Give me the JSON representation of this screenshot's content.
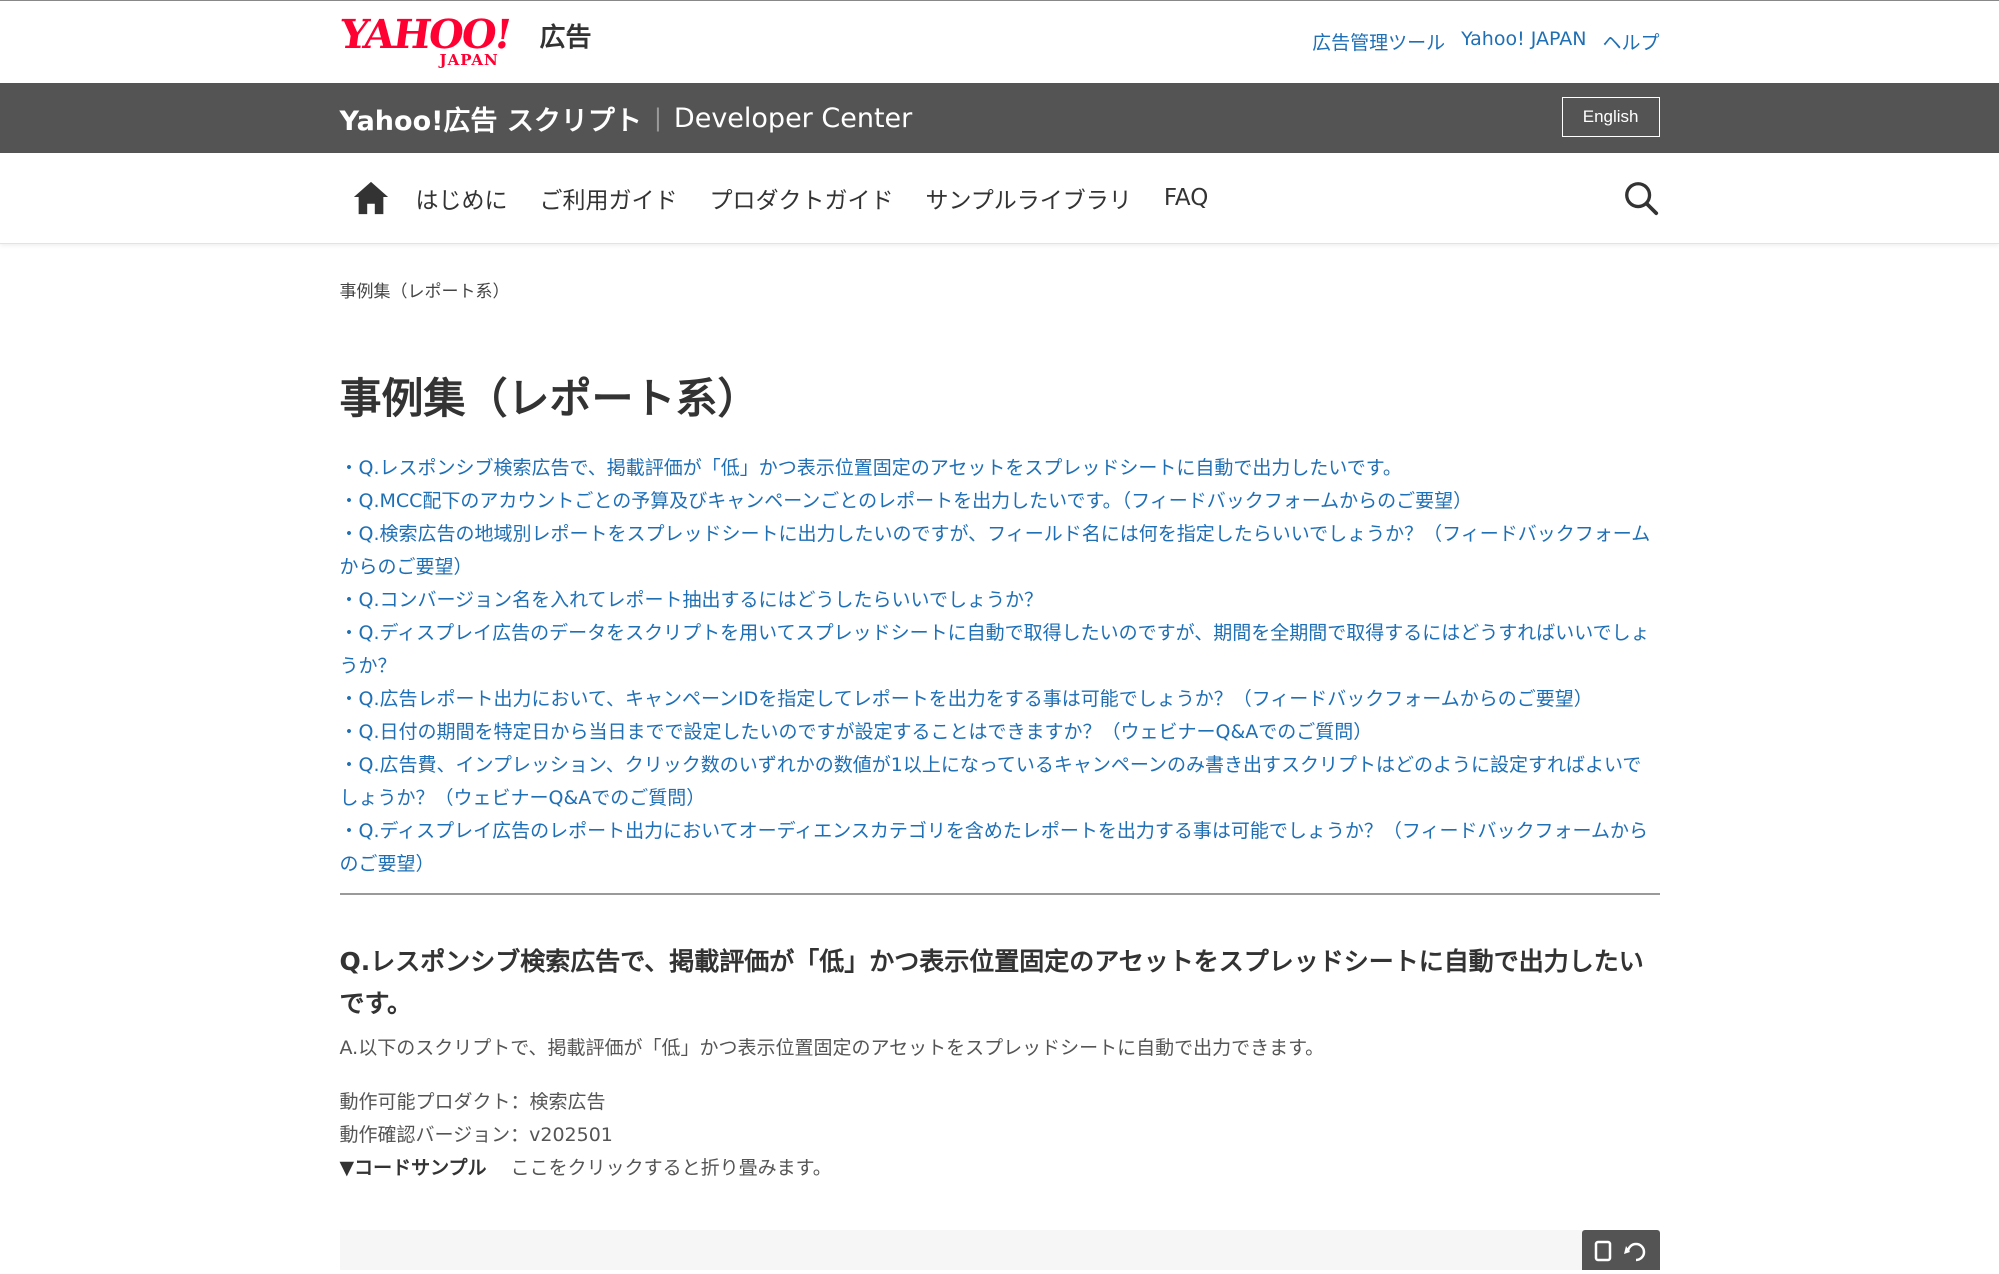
{
  "header": {
    "logo_word": "YAHOO!",
    "logo_sub": "JAPAN",
    "logo_ad": "広告",
    "links": [
      "広告管理ツール",
      "Yahoo! JAPAN",
      "ヘルプ"
    ]
  },
  "brandbar": {
    "brand": "Yahoo!広告 スクリプト",
    "separator": "|",
    "subtitle": "Developer Center",
    "language_button": "English"
  },
  "nav": {
    "items": [
      "はじめに",
      "ご利用ガイド",
      "プロダクトガイド",
      "サンプルライブラリ",
      "FAQ"
    ],
    "home_icon": "home-icon",
    "search_icon": "search-icon"
  },
  "breadcrumb": "事例集（レポート系）",
  "page_title": "事例集（レポート系）",
  "toc": [
    "・Q.レスポンシブ検索広告で、掲載評価が「低」かつ表示位置固定のアセットをスプレッドシートに自動で出力したいです。",
    "・Q.MCC配下のアカウントごとの予算及びキャンペーンごとのレポートを出力したいです。（フィードバックフォームからのご要望）",
    "・Q.検索広告の地域別レポートをスプレッドシートに出力したいのですが、フィールド名には何を指定したらいいでしょうか？（フィードバックフォームからのご要望）",
    "・Q.コンバージョン名を入れてレポート抽出するにはどうしたらいいでしょうか？",
    "・Q.ディスプレイ広告のデータをスクリプトを用いてスプレッドシートに自動で取得したいのですが、期間を全期間で取得するにはどうすればいいでしょうか？",
    "・Q.広告レポート出力において、キャンペーンIDを指定してレポートを出力をする事は可能でしょうか？（フィードバックフォームからのご要望）",
    "・Q.日付の期間を特定日から当日までで設定したいのですが設定することはできますか？（ウェビナーQ&Aでのご質問）",
    "・Q.広告費、インプレッション、クリック数のいずれかの数値が1以上になっているキャンペーンのみ書き出すスクリプトはどのように設定すればよいでしょうか？（ウェビナーQ&Aでのご質問）",
    "・Q.ディスプレイ広告のレポート出力においてオーディエンスカテゴリを含めたレポートを出力する事は可能でしょうか？（フィードバックフォームからのご要望）"
  ],
  "section1": {
    "question": "Q.レスポンシブ検索広告で、掲載評価が「低」かつ表示位置固定のアセットをスプレッドシートに自動で出力したいです。",
    "answer": "A.以下のスクリプトで、掲載評価が「低」かつ表示位置固定のアセットをスプレッドシートに自動で出力できます。",
    "product": "動作可能プロダクト：検索広告",
    "version": "動作確認バージョン：v202501",
    "code_label": "▼コードサンプル",
    "code_hint": "ここをクリックすると折り畳みます。"
  },
  "colors": {
    "link": "#1f6fb5",
    "brandbar_bg": "#545454",
    "logo_red": "#ff0033"
  }
}
